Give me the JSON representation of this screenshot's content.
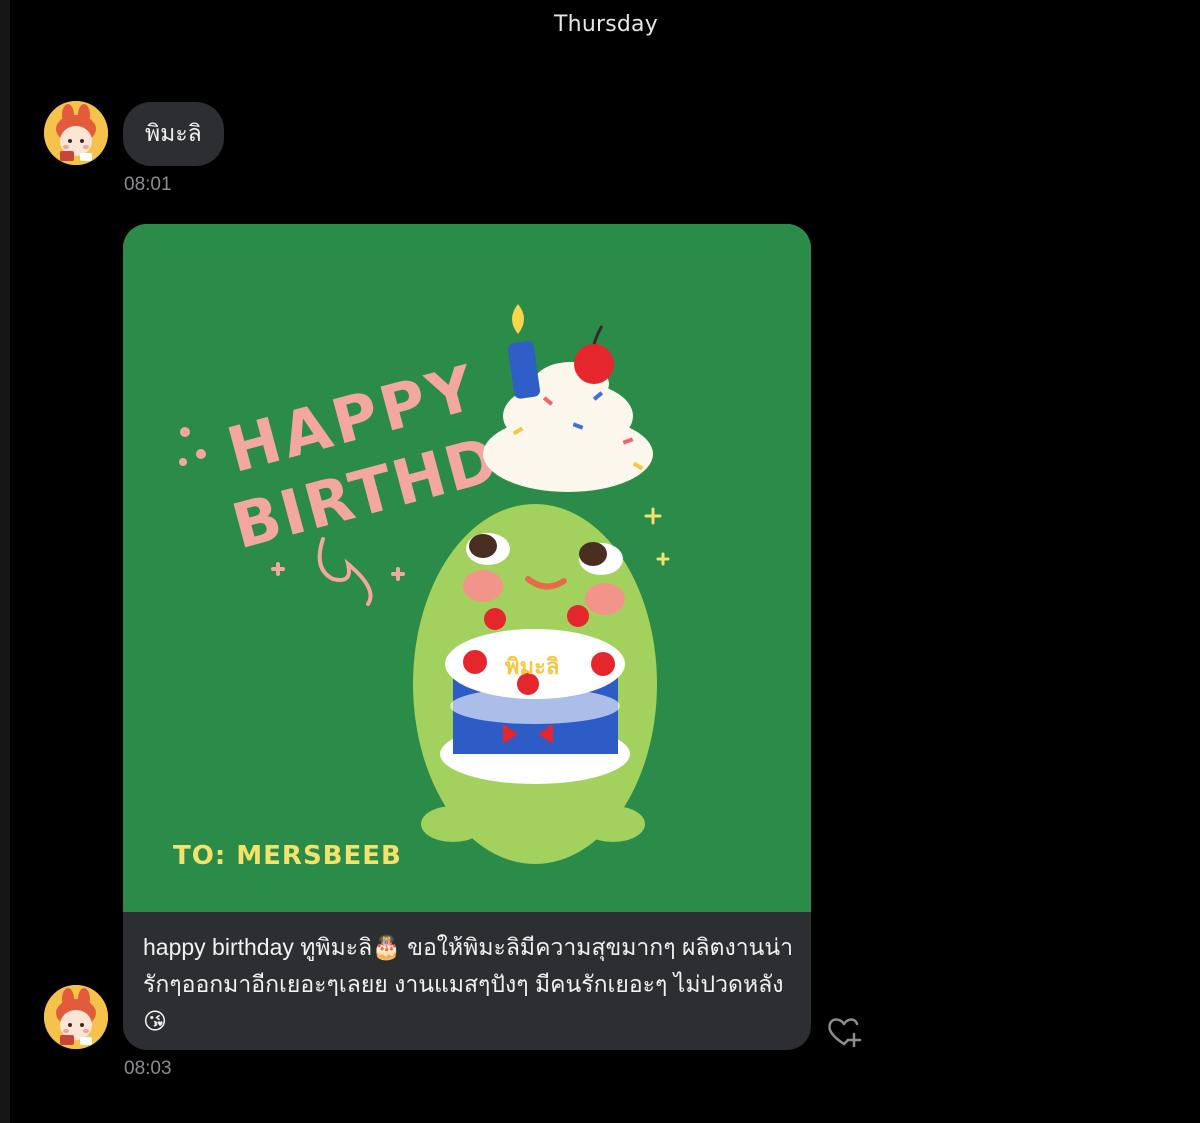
{
  "day_separator": "Thursday",
  "messages": [
    {
      "sender": "พิมะลิ",
      "time": "08:01",
      "avatar_icon": "bunny-girl-avatar"
    },
    {
      "type": "sticker-card",
      "time": "08:03",
      "avatar_icon": "bunny-girl-avatar",
      "image": {
        "headline_line1": "HAPPY",
        "headline_line2": "BIRTHDAY",
        "cake_label": "พิมะลิ",
        "signature": "TO: MERSBEEB",
        "background": "#2a8c48"
      },
      "text": "happy birthday ทูพิมะลิ🎂 ขอให้พิมะลิมีความสุขมากๆ ผลิตงานน่ารักๆออกมาอีกเยอะๆเลยย งานแมสๆปังๆ มีคนรักเยอะๆ ไม่ปวดหลัง😘"
    }
  ],
  "react_button_icon": "heart-plus-icon",
  "colors": {
    "background": "#000000",
    "bubble": "#2d2e31",
    "timestamp": "#8b8d91",
    "headline": "#f4a7a0",
    "signature": "#f4e26b"
  }
}
